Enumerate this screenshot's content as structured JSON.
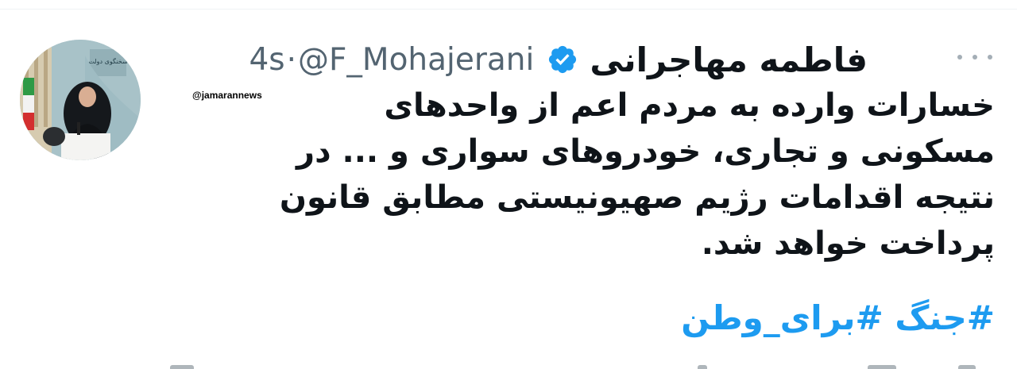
{
  "tweet": {
    "display_name": "فاطمه مهاجرانی",
    "handle": "@F_Mohajerani",
    "separator": "·",
    "timestamp": "4s",
    "verified_icon": "verified-badge-icon",
    "more_icon": "more-options-icon",
    "watermark": "@jamarannews",
    "text_lines": [
      "خسارات وارده به مردم اعم از واحدهای",
      "مسکونی و تجاری، خودروهای سواری و ... در",
      "نتیجه اقدامات رژیم صهیونیستی مطابق قانون",
      "پرداخت خواهد شد."
    ],
    "hashtags": [
      "#جنگ",
      "#برای_وطن"
    ]
  },
  "colors": {
    "text": "#0f1419",
    "secondary": "#536471",
    "accent": "#1d9bf0",
    "verified": "#1d9bf0"
  }
}
